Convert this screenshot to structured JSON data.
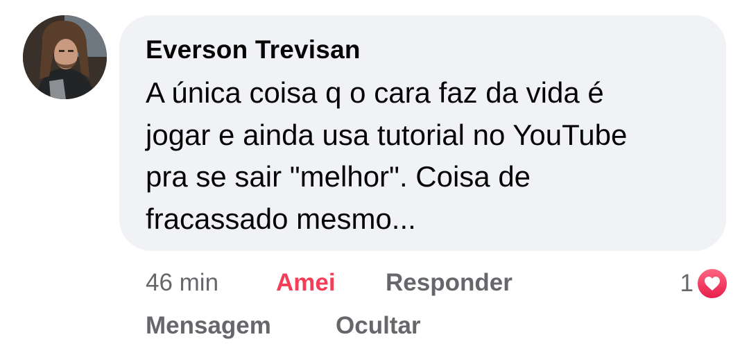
{
  "comment": {
    "author": "Everson Trevisan",
    "text_lines": [
      "A única coisa q o cara faz da vida é",
      "jogar e ainda usa tutorial no YouTube",
      "pra se sair \"melhor\". Coisa de",
      "fracassado mesmo..."
    ],
    "time": "46 min",
    "reaction_count": "1",
    "reaction_icon": "heart-icon"
  },
  "actions": {
    "love_label": "Amei",
    "reply_label": "Responder",
    "message_label": "Mensagem",
    "hide_label": "Ocultar"
  },
  "colors": {
    "bubble": "#f0f2f5",
    "love": "#f33e58",
    "meta": "#65676b",
    "text": "#050505"
  }
}
